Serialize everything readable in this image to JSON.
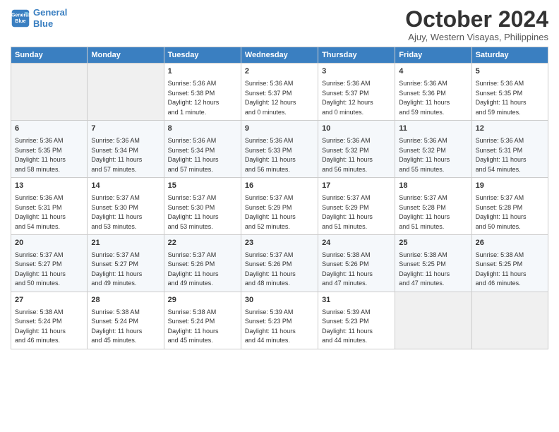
{
  "header": {
    "logo_line1": "General",
    "logo_line2": "Blue",
    "month_title": "October 2024",
    "location": "Ajuy, Western Visayas, Philippines"
  },
  "weekdays": [
    "Sunday",
    "Monday",
    "Tuesday",
    "Wednesday",
    "Thursday",
    "Friday",
    "Saturday"
  ],
  "weeks": [
    [
      {
        "day": "",
        "content": ""
      },
      {
        "day": "",
        "content": ""
      },
      {
        "day": "1",
        "content": "Sunrise: 5:36 AM\nSunset: 5:38 PM\nDaylight: 12 hours\nand 1 minute."
      },
      {
        "day": "2",
        "content": "Sunrise: 5:36 AM\nSunset: 5:37 PM\nDaylight: 12 hours\nand 0 minutes."
      },
      {
        "day": "3",
        "content": "Sunrise: 5:36 AM\nSunset: 5:37 PM\nDaylight: 12 hours\nand 0 minutes."
      },
      {
        "day": "4",
        "content": "Sunrise: 5:36 AM\nSunset: 5:36 PM\nDaylight: 11 hours\nand 59 minutes."
      },
      {
        "day": "5",
        "content": "Sunrise: 5:36 AM\nSunset: 5:35 PM\nDaylight: 11 hours\nand 59 minutes."
      }
    ],
    [
      {
        "day": "6",
        "content": "Sunrise: 5:36 AM\nSunset: 5:35 PM\nDaylight: 11 hours\nand 58 minutes."
      },
      {
        "day": "7",
        "content": "Sunrise: 5:36 AM\nSunset: 5:34 PM\nDaylight: 11 hours\nand 57 minutes."
      },
      {
        "day": "8",
        "content": "Sunrise: 5:36 AM\nSunset: 5:34 PM\nDaylight: 11 hours\nand 57 minutes."
      },
      {
        "day": "9",
        "content": "Sunrise: 5:36 AM\nSunset: 5:33 PM\nDaylight: 11 hours\nand 56 minutes."
      },
      {
        "day": "10",
        "content": "Sunrise: 5:36 AM\nSunset: 5:32 PM\nDaylight: 11 hours\nand 56 minutes."
      },
      {
        "day": "11",
        "content": "Sunrise: 5:36 AM\nSunset: 5:32 PM\nDaylight: 11 hours\nand 55 minutes."
      },
      {
        "day": "12",
        "content": "Sunrise: 5:36 AM\nSunset: 5:31 PM\nDaylight: 11 hours\nand 54 minutes."
      }
    ],
    [
      {
        "day": "13",
        "content": "Sunrise: 5:36 AM\nSunset: 5:31 PM\nDaylight: 11 hours\nand 54 minutes."
      },
      {
        "day": "14",
        "content": "Sunrise: 5:37 AM\nSunset: 5:30 PM\nDaylight: 11 hours\nand 53 minutes."
      },
      {
        "day": "15",
        "content": "Sunrise: 5:37 AM\nSunset: 5:30 PM\nDaylight: 11 hours\nand 53 minutes."
      },
      {
        "day": "16",
        "content": "Sunrise: 5:37 AM\nSunset: 5:29 PM\nDaylight: 11 hours\nand 52 minutes."
      },
      {
        "day": "17",
        "content": "Sunrise: 5:37 AM\nSunset: 5:29 PM\nDaylight: 11 hours\nand 51 minutes."
      },
      {
        "day": "18",
        "content": "Sunrise: 5:37 AM\nSunset: 5:28 PM\nDaylight: 11 hours\nand 51 minutes."
      },
      {
        "day": "19",
        "content": "Sunrise: 5:37 AM\nSunset: 5:28 PM\nDaylight: 11 hours\nand 50 minutes."
      }
    ],
    [
      {
        "day": "20",
        "content": "Sunrise: 5:37 AM\nSunset: 5:27 PM\nDaylight: 11 hours\nand 50 minutes."
      },
      {
        "day": "21",
        "content": "Sunrise: 5:37 AM\nSunset: 5:27 PM\nDaylight: 11 hours\nand 49 minutes."
      },
      {
        "day": "22",
        "content": "Sunrise: 5:37 AM\nSunset: 5:26 PM\nDaylight: 11 hours\nand 49 minutes."
      },
      {
        "day": "23",
        "content": "Sunrise: 5:37 AM\nSunset: 5:26 PM\nDaylight: 11 hours\nand 48 minutes."
      },
      {
        "day": "24",
        "content": "Sunrise: 5:38 AM\nSunset: 5:26 PM\nDaylight: 11 hours\nand 47 minutes."
      },
      {
        "day": "25",
        "content": "Sunrise: 5:38 AM\nSunset: 5:25 PM\nDaylight: 11 hours\nand 47 minutes."
      },
      {
        "day": "26",
        "content": "Sunrise: 5:38 AM\nSunset: 5:25 PM\nDaylight: 11 hours\nand 46 minutes."
      }
    ],
    [
      {
        "day": "27",
        "content": "Sunrise: 5:38 AM\nSunset: 5:24 PM\nDaylight: 11 hours\nand 46 minutes."
      },
      {
        "day": "28",
        "content": "Sunrise: 5:38 AM\nSunset: 5:24 PM\nDaylight: 11 hours\nand 45 minutes."
      },
      {
        "day": "29",
        "content": "Sunrise: 5:38 AM\nSunset: 5:24 PM\nDaylight: 11 hours\nand 45 minutes."
      },
      {
        "day": "30",
        "content": "Sunrise: 5:39 AM\nSunset: 5:23 PM\nDaylight: 11 hours\nand 44 minutes."
      },
      {
        "day": "31",
        "content": "Sunrise: 5:39 AM\nSunset: 5:23 PM\nDaylight: 11 hours\nand 44 minutes."
      },
      {
        "day": "",
        "content": ""
      },
      {
        "day": "",
        "content": ""
      }
    ]
  ]
}
